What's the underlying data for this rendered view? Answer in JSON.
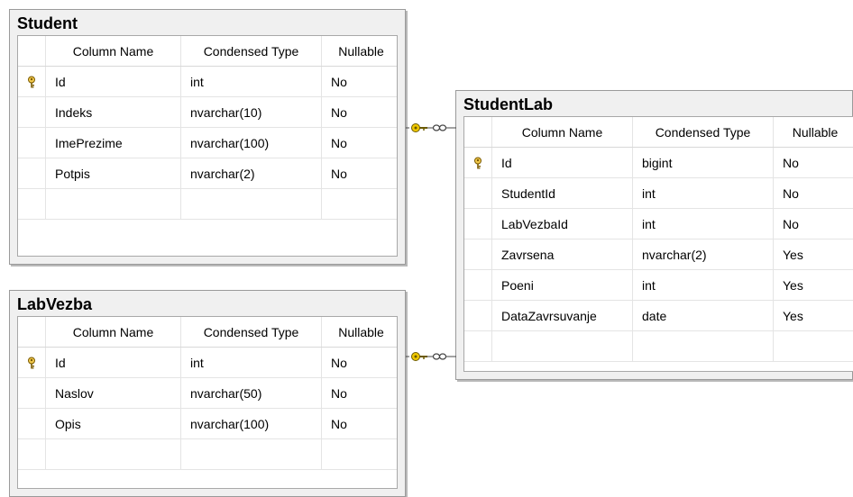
{
  "tables": {
    "student": {
      "name": "Student",
      "headers": {
        "column_name": "Column Name",
        "condensed_type": "Condensed Type",
        "nullable": "Nullable"
      },
      "rows": [
        {
          "key": true,
          "name": "Id",
          "type": "int",
          "nullable": "No"
        },
        {
          "key": false,
          "name": "Indeks",
          "type": "nvarchar(10)",
          "nullable": "No"
        },
        {
          "key": false,
          "name": "ImePrezime",
          "type": "nvarchar(100)",
          "nullable": "No"
        },
        {
          "key": false,
          "name": "Potpis",
          "type": "nvarchar(2)",
          "nullable": "No"
        }
      ]
    },
    "labvezba": {
      "name": "LabVezba",
      "headers": {
        "column_name": "Column Name",
        "condensed_type": "Condensed Type",
        "nullable": "Nullable"
      },
      "rows": [
        {
          "key": true,
          "name": "Id",
          "type": "int",
          "nullable": "No"
        },
        {
          "key": false,
          "name": "Naslov",
          "type": "nvarchar(50)",
          "nullable": "No"
        },
        {
          "key": false,
          "name": "Opis",
          "type": "nvarchar(100)",
          "nullable": "No"
        }
      ]
    },
    "studentlab": {
      "name": "StudentLab",
      "headers": {
        "column_name": "Column Name",
        "condensed_type": "Condensed Type",
        "nullable": "Nullable"
      },
      "rows": [
        {
          "key": true,
          "name": "Id",
          "type": "bigint",
          "nullable": "No"
        },
        {
          "key": false,
          "name": "StudentId",
          "type": "int",
          "nullable": "No"
        },
        {
          "key": false,
          "name": "LabVezbaId",
          "type": "int",
          "nullable": "No"
        },
        {
          "key": false,
          "name": "Zavrsena",
          "type": "nvarchar(2)",
          "nullable": "Yes"
        },
        {
          "key": false,
          "name": "Poeni",
          "type": "int",
          "nullable": "Yes"
        },
        {
          "key": false,
          "name": "DataZavrsuvanje",
          "type": "date",
          "nullable": "Yes"
        }
      ]
    }
  },
  "relationships": [
    {
      "from": "Student",
      "to": "StudentLab",
      "icon": "key-to-infinity-relationship-icon"
    },
    {
      "from": "LabVezba",
      "to": "StudentLab",
      "icon": "key-to-infinity-relationship-icon"
    }
  ],
  "colors": {
    "key_icon": "#d4a017",
    "relationship_icon": "#c9a100",
    "title_bar": "#f0f0f0",
    "grid_border": "#a8a8a8"
  }
}
